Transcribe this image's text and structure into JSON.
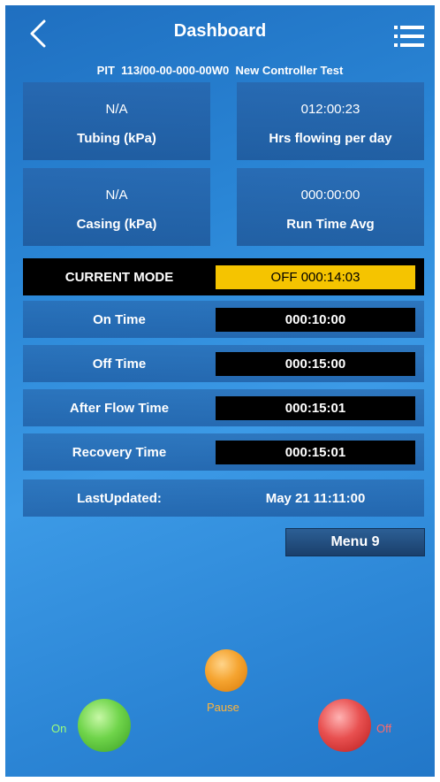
{
  "header": {
    "title": "Dashboard",
    "back_icon": "chevron-left-icon",
    "menu_icon": "list-menu-icon"
  },
  "subheader": {
    "text": "PIT  113/00-00-000-00W0  New Controller Test"
  },
  "tiles": [
    {
      "value": "N/A",
      "label": "Tubing (kPa)"
    },
    {
      "value": "012:00:23",
      "label": "Hrs flowing per day"
    },
    {
      "value": "N/A",
      "label": "Casing (kPa)"
    },
    {
      "value": "000:00:00",
      "label": "Run Time Avg"
    }
  ],
  "rows": [
    {
      "label": "CURRENT MODE",
      "value": "OFF 000:14:03"
    },
    {
      "label": "On Time",
      "value": "000:10:00"
    },
    {
      "label": "Off Time",
      "value": "000:15:00"
    },
    {
      "label": "After Flow Time",
      "value": "000:15:01"
    },
    {
      "label": "Recovery Time",
      "value": "000:15:01"
    },
    {
      "label": "LastUpdated:",
      "value": "May 21 11:11:00"
    }
  ],
  "menu_button": {
    "label": "Menu 9"
  },
  "controls": {
    "on_label": "On",
    "pause_label": "Pause",
    "off_label": "Off"
  },
  "colors": {
    "mode_highlight": "#f5c400",
    "on": "#6fd44a",
    "pause": "#f5a430",
    "off": "#e85050"
  }
}
